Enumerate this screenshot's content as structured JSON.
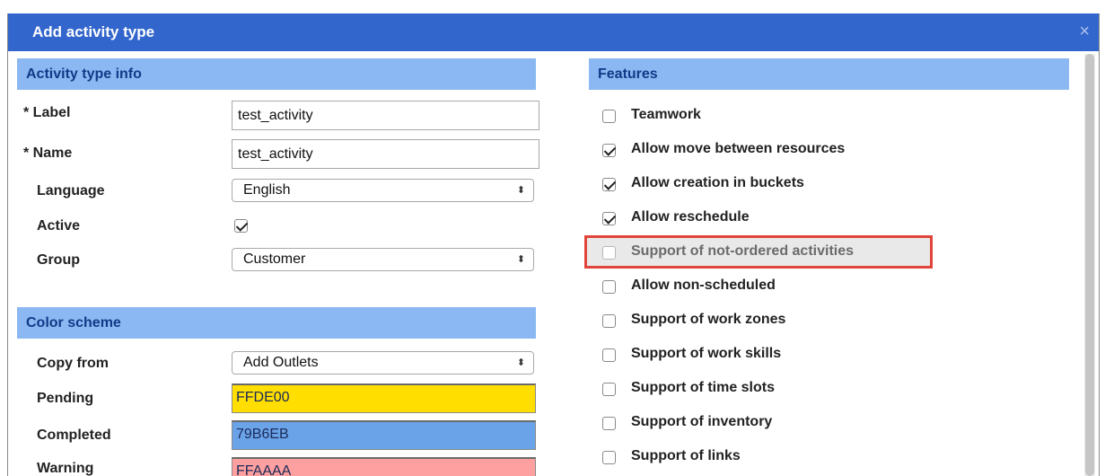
{
  "dialog": {
    "title": "Add activity type",
    "close_glyph": "×"
  },
  "info": {
    "header": "Activity type info",
    "label_label": "* Label",
    "label_value": "test_activity",
    "name_label": "* Name",
    "name_value": "test_activity",
    "language_label": "Language",
    "language_value": "English",
    "active_label": "Active",
    "active_checked": true,
    "group_label": "Group",
    "group_value": "Customer"
  },
  "colors": {
    "header": "Color scheme",
    "copy_from_label": "Copy from",
    "copy_from_value": "Add Outlets",
    "pending_label": "Pending",
    "pending_value": "FFDE00",
    "completed_label": "Completed",
    "completed_value": "79B6EB",
    "warning_label": "Warning",
    "warning_value": "FFAAAA"
  },
  "features": {
    "header": "Features",
    "items": [
      {
        "label": "Teamwork",
        "checked": false
      },
      {
        "label": "Allow move between resources",
        "checked": true
      },
      {
        "label": "Allow creation in buckets",
        "checked": true
      },
      {
        "label": "Allow reschedule",
        "checked": true
      },
      {
        "label": "Support of not-ordered activities",
        "checked": false,
        "disabled": true,
        "highlighted": true
      },
      {
        "label": "Allow non-scheduled",
        "checked": false
      },
      {
        "label": "Support of work zones",
        "checked": false
      },
      {
        "label": "Support of work skills",
        "checked": false
      },
      {
        "label": "Support of time slots",
        "checked": false
      },
      {
        "label": "Support of inventory",
        "checked": false
      },
      {
        "label": "Support of links",
        "checked": false
      }
    ]
  },
  "theme": {
    "titlebar": "#3366cc",
    "section_header": "#8bb8f2",
    "pending_color": "#FFDE00",
    "completed_color": "#6BA3E8",
    "warning_color": "#FFA0A0",
    "highlight_border": "#e0443a"
  }
}
